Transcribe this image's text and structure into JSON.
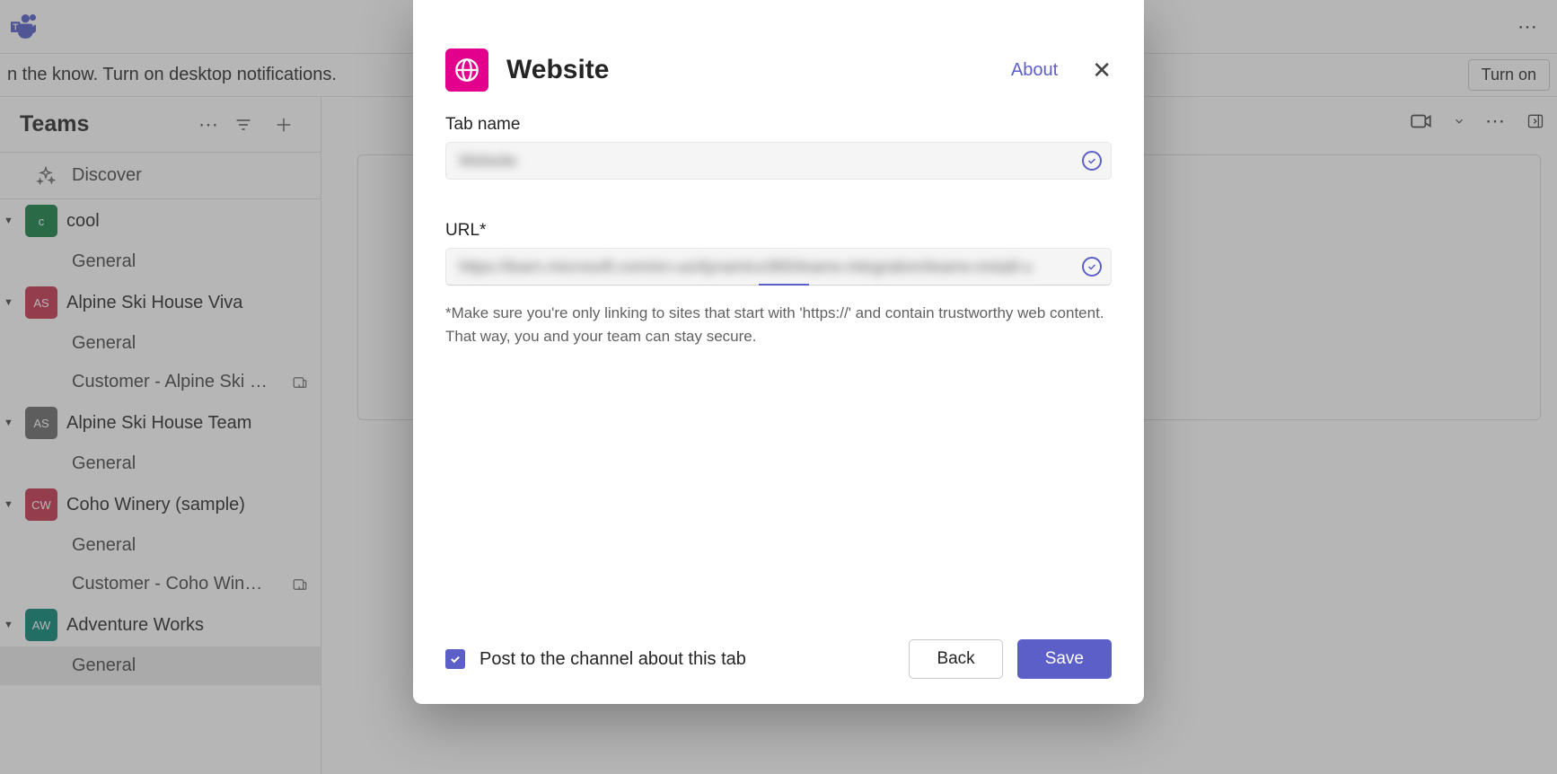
{
  "topbar": {
    "more_label": "..."
  },
  "notif": {
    "text": "n the know. Turn on desktop notifications.",
    "turn_on": "Turn on"
  },
  "sidebar": {
    "title": "Teams",
    "discover": "Discover",
    "teams": [
      {
        "name": "cool",
        "avatar_text": "c",
        "avatar_bg": "#107c41",
        "channels": [
          {
            "name": "General",
            "icon": false,
            "active": false
          }
        ]
      },
      {
        "name": "Alpine Ski House Viva",
        "avatar_text": "AS",
        "avatar_bg": "#c4314b",
        "channels": [
          {
            "name": "General",
            "icon": false,
            "active": false
          },
          {
            "name": "Customer - Alpine Ski …",
            "icon": true,
            "active": false
          }
        ]
      },
      {
        "name": "Alpine Ski House Team",
        "avatar_text": "AS",
        "avatar_bg": "#666666",
        "channels": [
          {
            "name": "General",
            "icon": false,
            "active": false
          }
        ]
      },
      {
        "name": "Coho Winery (sample)",
        "avatar_text": "CW",
        "avatar_bg": "#c4314b",
        "channels": [
          {
            "name": "General",
            "icon": false,
            "active": false
          },
          {
            "name": "Customer - Coho Wine…",
            "icon": true,
            "active": false
          }
        ]
      },
      {
        "name": "Adventure Works",
        "avatar_text": "AW",
        "avatar_bg": "#008272",
        "channels": [
          {
            "name": "General",
            "icon": false,
            "active": true
          }
        ]
      }
    ]
  },
  "modal": {
    "app_name": "Website",
    "about": "About",
    "tab_name_label": "Tab name",
    "tab_name_value": "Website",
    "url_label": "URL*",
    "url_value": "https://learn.microsoft.com/en-us/dynamics365/teams-integration/teams-install-u",
    "helper": "*Make sure you're only linking to sites that start with 'https://' and contain trustworthy web content. That way, you and your team can stay secure.",
    "post_checkbox": "Post to the channel about this tab",
    "post_checked": true,
    "back": "Back",
    "save": "Save"
  }
}
